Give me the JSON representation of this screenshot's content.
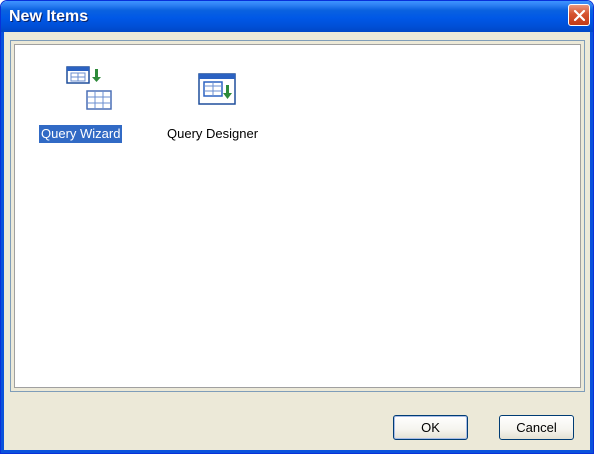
{
  "window": {
    "title": "New Items"
  },
  "items": [
    {
      "label": "Query Wizard",
      "icon": "query-wizard-icon",
      "selected": true
    },
    {
      "label": "Query Designer",
      "icon": "query-designer-icon",
      "selected": false
    }
  ],
  "buttons": {
    "ok_label": "OK",
    "cancel_label": "Cancel"
  },
  "colors": {
    "titlebar": "#0058e6",
    "selection": "#316ac5",
    "close_button": "#d6532f",
    "dialog_bg": "#ece9d8"
  }
}
